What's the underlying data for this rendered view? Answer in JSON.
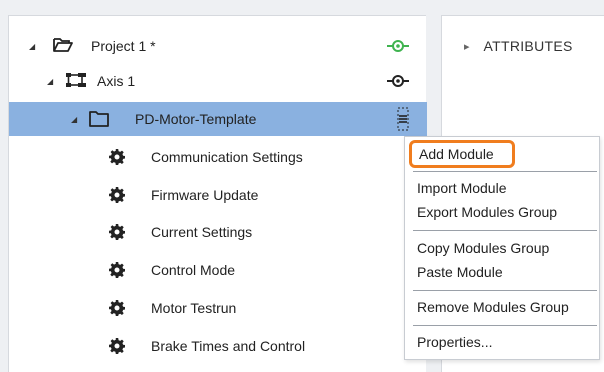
{
  "tree": {
    "project": {
      "label": "Project 1 *"
    },
    "axis": {
      "label": "Axis 1"
    },
    "template": {
      "label": "PD-Motor-Template"
    },
    "items": [
      {
        "label": "Communication Settings"
      },
      {
        "label": "Firmware Update"
      },
      {
        "label": "Current Settings"
      },
      {
        "label": "Control Mode"
      },
      {
        "label": "Motor Testrun"
      },
      {
        "label": "Brake Times and Control"
      }
    ]
  },
  "attributes": {
    "title": "ATTRIBUTES"
  },
  "context_menu": {
    "add_module": "Add Module",
    "import_module": "Import Module",
    "export_modules_group": "Export Modules Group",
    "copy_modules_group": "Copy Modules Group",
    "paste_module": "Paste Module",
    "remove_modules_group": "Remove Modules Group",
    "properties": "Properties..."
  },
  "colors": {
    "selection": "#8ab1e0",
    "connected": "#3fb34f",
    "highlight_border": "#f07d1e"
  },
  "icons": {
    "project": "folder-open-icon",
    "axis": "axis-network-icon",
    "template": "folder-icon",
    "item": "gear-icon",
    "project_status": "connected-icon",
    "axis_status": "disconnected-icon",
    "template_menu": "menu-handle-icon"
  }
}
